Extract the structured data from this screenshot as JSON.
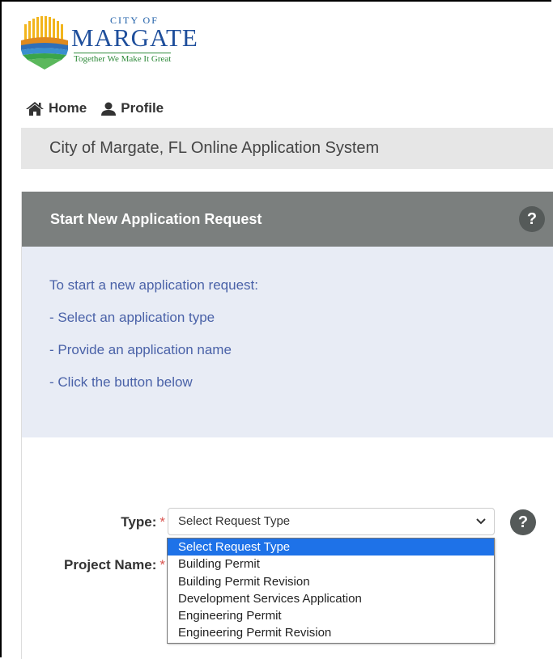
{
  "logo": {
    "city_of": "CITY OF",
    "name": "MARGATE",
    "tagline": "Together We Make It Great"
  },
  "nav": {
    "home_label": "Home",
    "profile_label": "Profile"
  },
  "banner": {
    "title": "City of Margate, FL Online Application System"
  },
  "panel": {
    "header_title": "Start New Application Request",
    "help_glyph": "?",
    "instructions": [
      "To start a new application request:",
      "- Select an application type",
      "- Provide an application name",
      "- Click the button below"
    ]
  },
  "form": {
    "type_label": "Type:",
    "project_name_label": "Project Name:",
    "required_marker": "*",
    "type_selected": "Select Request Type",
    "help_glyph": "?",
    "type_options": [
      "Select Request Type",
      "Building Permit",
      "Building Permit Revision",
      "Development Services Application",
      "Engineering Permit",
      "Engineering Permit Revision"
    ]
  },
  "colors": {
    "header_bg": "#7b7f7e",
    "info_bg": "#e8ecf5",
    "info_text": "#4a62a8",
    "selected_option": "#1e72e8",
    "required": "#d9534f"
  }
}
